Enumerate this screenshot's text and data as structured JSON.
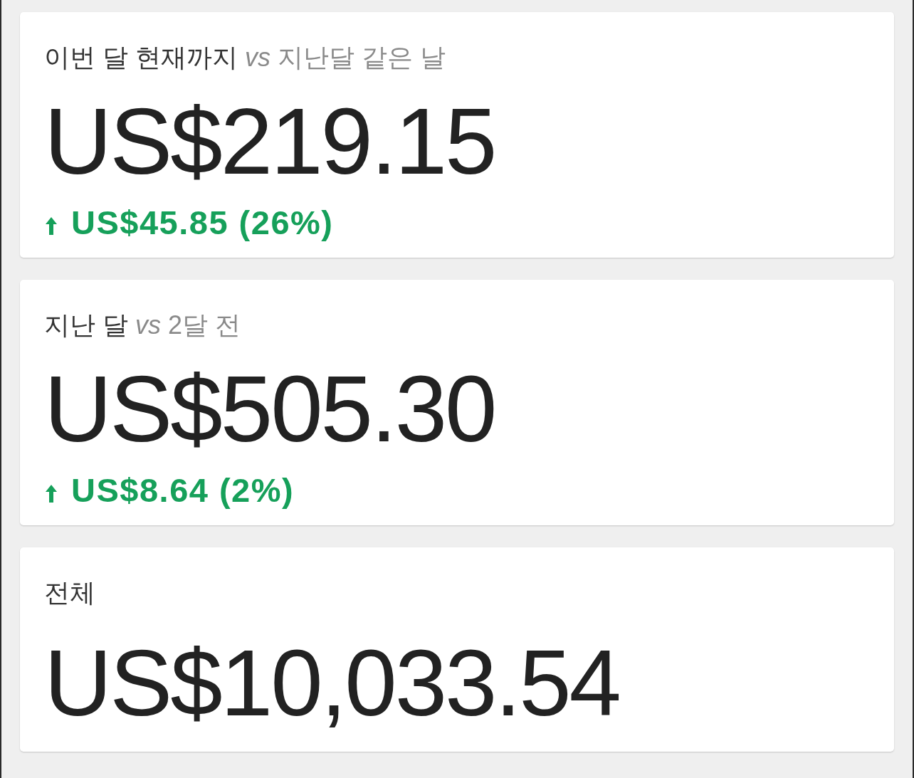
{
  "cards": [
    {
      "title": {
        "period": "이번 달 현재까지",
        "connector": "vs",
        "comparison": "지난달 같은 날"
      },
      "amount": "US$219.15",
      "change": {
        "kind": "increase",
        "text": "US$45.85 (26%)"
      }
    },
    {
      "title": {
        "period": "지난 달",
        "connector": "vs",
        "comparison": "2달 전"
      },
      "amount": "US$505.30",
      "change": {
        "kind": "increase",
        "text": "US$8.64 (2%)"
      }
    },
    {
      "title": {
        "period": "전체"
      },
      "amount": "US$10,033.54"
    }
  ]
}
